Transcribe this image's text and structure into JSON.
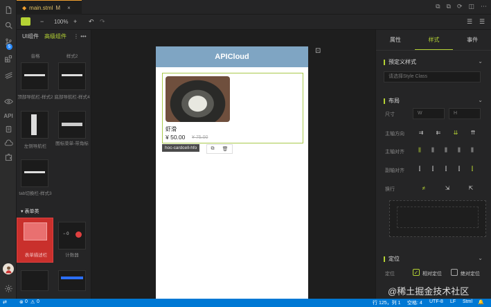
{
  "tab": {
    "filename": "main.stml",
    "modified": "M"
  },
  "activity": {
    "badge": "5",
    "api_label": "API"
  },
  "toolbar": {
    "zoom": "100%"
  },
  "left_panel": {
    "tabs": [
      "UI组件",
      "高级组件"
    ],
    "top_labels": [
      "音格",
      "样式2"
    ],
    "items": [
      "顶部导航栏-样式2",
      "底部导航栏-样式4",
      "左侧导航栏",
      "图标菜单-带角标",
      "tab切换栏-样式3"
    ],
    "section": "表单类",
    "items2": [
      "表单描述栏",
      "计数器"
    ],
    "counter_text": "0"
  },
  "phone": {
    "header_title": "APICloud",
    "card_title": "虾滑",
    "price": "¥ 50.00",
    "old_price": "¥ 75.00",
    "tag_name": "hoc-cardcell-hfo"
  },
  "right_panel": {
    "tabs": [
      "属性",
      "样式",
      "事件"
    ],
    "predefined_title": "预定义样式",
    "predefined_placeholder": "请选择Style Class",
    "layout_title": "布局",
    "size_label": "尺寸",
    "w_label": "W",
    "h_label": "H",
    "main_dir_label": "主轴方向",
    "main_align_label": "主轴对齐",
    "cross_align_label": "副轴对齐",
    "wrap_label": "换行",
    "position_title": "定位",
    "position_label": "定位",
    "relative_label": "相对定位",
    "absolute_label": "绝对定位"
  },
  "status": {
    "errors": "0",
    "warnings": "0",
    "cursor": "行 125，列 1",
    "spaces": "空格: 4",
    "encoding": "UTF-8",
    "eol": "LF",
    "lang": "Stml"
  },
  "watermark": "@稀土掘金技术社区",
  "colors": {
    "accent": "#b5d334",
    "status_bar": "#0078d4",
    "phone_header": "#7fa5c3"
  }
}
